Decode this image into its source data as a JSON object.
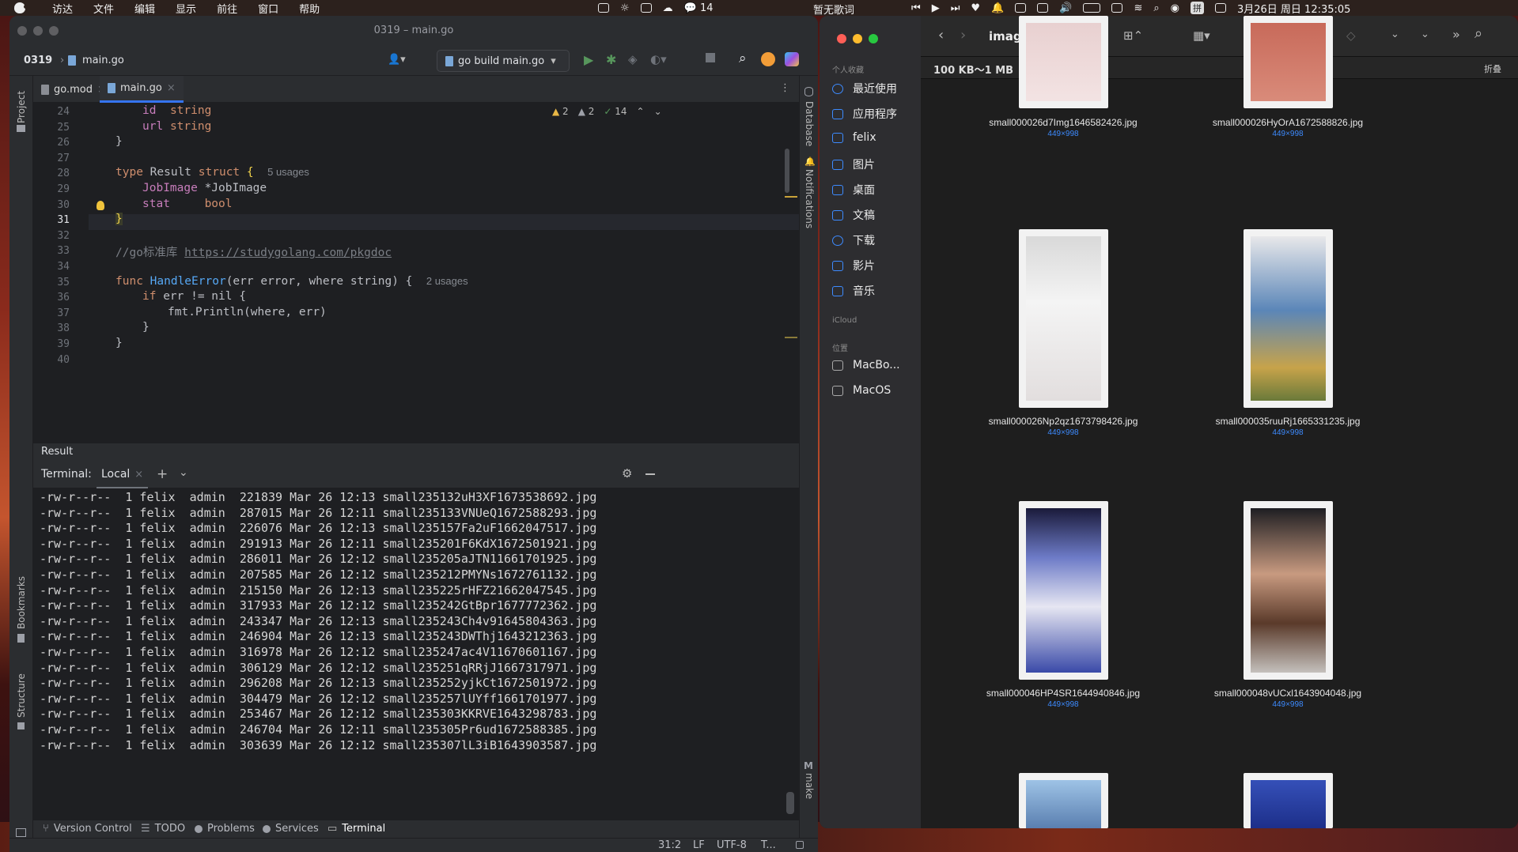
{
  "menubar": {
    "items": [
      "访达",
      "文件",
      "编辑",
      "显示",
      "前往",
      "窗口",
      "帮助"
    ],
    "wechat_badge": "14",
    "lyrics": "暂无歌词",
    "datetime": "3月26日 周日 12:35:05",
    "ime": "拼"
  },
  "ide": {
    "window_title": "0319 – main.go",
    "breadcrumb_project": "0319",
    "breadcrumb_file": "main.go",
    "run_config": "go build main.go",
    "tabs": [
      {
        "label": "go.mod"
      },
      {
        "label": "main.go"
      }
    ],
    "inspections": {
      "warnings": "2",
      "weak_warnings": "2",
      "ok": "14"
    },
    "side_left": [
      "Project",
      "Bookmarks",
      "Structure"
    ],
    "side_right": [
      "Database",
      "Notifications",
      "make"
    ],
    "line_numbers": [
      "24",
      "25",
      "26",
      "27",
      "28",
      "29",
      "30",
      "31",
      "32",
      "33",
      "34",
      "35",
      "36",
      "37",
      "38",
      "39",
      "40"
    ],
    "code": {
      "l24_a": "id",
      "l24_b": "string",
      "l25_a": "url",
      "l25_b": "string",
      "l26": "}",
      "l28_kw1": "type",
      "l28_name": "Result",
      "l28_kw2": "struct",
      "l28_brace": "{",
      "l28_hint": "5 usages",
      "l29_a": "JobImage",
      "l29_b": "*JobImage",
      "l30_a": "stat",
      "l30_b": "bool",
      "l31": "}",
      "l33_cmt": "//go标准库 ",
      "l33_link": "https://studygolang.com/pkgdoc",
      "l35_kw": "func",
      "l35_fn": "HandleError",
      "l35_sig": "(err error, where string) {",
      "l35_hint": "2 usages",
      "l36_kw": "if",
      "l36_rest": "err != nil {",
      "l37": "fmt.Println(where, err)",
      "l38": "}",
      "l39": "}"
    },
    "result_label": "Result",
    "terminal": {
      "label": "Terminal:",
      "tab": "Local",
      "rows": [
        "-rw-r--r--  1 felix  admin  221839 Mar 26 12:13 small235132uH3XF1673538692.jpg",
        "-rw-r--r--  1 felix  admin  287015 Mar 26 12:11 small235133VNUeQ1672588293.jpg",
        "-rw-r--r--  1 felix  admin  226076 Mar 26 12:13 small235157Fa2uF1662047517.jpg",
        "-rw-r--r--  1 felix  admin  291913 Mar 26 12:11 small235201F6KdX1672501921.jpg",
        "-rw-r--r--  1 felix  admin  286011 Mar 26 12:12 small235205aJTN11661701925.jpg",
        "-rw-r--r--  1 felix  admin  207585 Mar 26 12:12 small235212PMYNs1672761132.jpg",
        "-rw-r--r--  1 felix  admin  215150 Mar 26 12:13 small235225rHFZ21662047545.jpg",
        "-rw-r--r--  1 felix  admin  317933 Mar 26 12:12 small235242GtBpr1677772362.jpg",
        "-rw-r--r--  1 felix  admin  243347 Mar 26 12:13 small235243Ch4v91645804363.jpg",
        "-rw-r--r--  1 felix  admin  246904 Mar 26 12:13 small235243DWThj1643212363.jpg",
        "-rw-r--r--  1 felix  admin  316978 Mar 26 12:12 small235247ac4V11670601167.jpg",
        "-rw-r--r--  1 felix  admin  306129 Mar 26 12:12 small235251qRRjJ1667317971.jpg",
        "-rw-r--r--  1 felix  admin  296208 Mar 26 12:13 small235252yjkCt1672501972.jpg",
        "-rw-r--r--  1 felix  admin  304479 Mar 26 12:12 small235257lUYff1661701977.jpg",
        "-rw-r--r--  1 felix  admin  253467 Mar 26 12:12 small235303KKRVE1643298783.jpg",
        "-rw-r--r--  1 felix  admin  246704 Mar 26 12:11 small235305Pr6ud1672588385.jpg",
        "-rw-r--r--  1 felix  admin  303639 Mar 26 12:12 small235307lL3iB1643903587.jpg"
      ]
    },
    "bottom_tabs": [
      "Version Control",
      "TODO",
      "Problems",
      "Services",
      "Terminal"
    ],
    "status": {
      "position": "31:2",
      "line_sep": "LF",
      "encoding": "UTF-8",
      "indent": "T..."
    }
  },
  "finder": {
    "title": "image",
    "path_info": "100 KB～1 MB",
    "collapse": "折叠",
    "section_favorites": "个人收藏",
    "favorites": [
      "最近使用",
      "应用程序",
      "felix",
      "图片",
      "桌面",
      "文稿",
      "下载",
      "影片",
      "音乐"
    ],
    "section_icloud": "iCloud",
    "section_locations": "位置",
    "locations": [
      "MacBo...",
      "MacOS"
    ],
    "files": [
      {
        "name": "small000026d7Img1646582426.jpg",
        "dims": "449×998"
      },
      {
        "name": "small000026HyOrA1672588826.jpg",
        "dims": "449×998"
      },
      {
        "name": "small000026Np2qz1673798426.jpg",
        "dims": "449×998"
      },
      {
        "name": "small000035ruuRj1665331235.jpg",
        "dims": "449×998"
      },
      {
        "name": "small000046HP4SR1644940846.jpg",
        "dims": "449×998"
      },
      {
        "name": "small000048vUCxl1643904048.jpg",
        "dims": "449×998"
      }
    ]
  }
}
